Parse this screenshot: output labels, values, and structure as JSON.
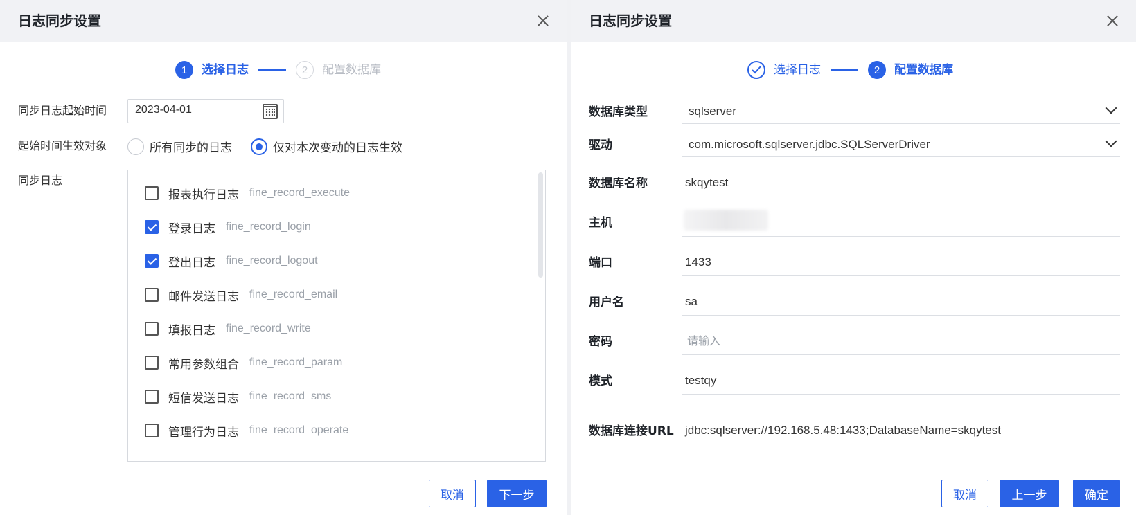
{
  "left": {
    "title": "日志同步设置",
    "steps": [
      {
        "num": "1",
        "label": "选择日志"
      },
      {
        "num": "2",
        "label": "配置数据库"
      }
    ],
    "start_time_label": "同步日志起始时间",
    "start_time_value": "2023-04-01",
    "scope_label": "起始时间生效对象",
    "scope_options": [
      {
        "label": "所有同步的日志",
        "checked": false
      },
      {
        "label": "仅对本次变动的日志生效",
        "checked": true
      }
    ],
    "sync_logs_label": "同步日志",
    "logs": [
      {
        "name": "报表执行日志",
        "table": "fine_record_execute",
        "checked": false
      },
      {
        "name": "登录日志",
        "table": "fine_record_login",
        "checked": true
      },
      {
        "name": "登出日志",
        "table": "fine_record_logout",
        "checked": true
      },
      {
        "name": "邮件发送日志",
        "table": "fine_record_email",
        "checked": false
      },
      {
        "name": "填报日志",
        "table": "fine_record_write",
        "checked": false
      },
      {
        "name": "常用参数组合",
        "table": "fine_record_param",
        "checked": false
      },
      {
        "name": "短信发送日志",
        "table": "fine_record_sms",
        "checked": false
      },
      {
        "name": "管理行为日志",
        "table": "fine_record_operate",
        "checked": false
      }
    ],
    "cancel_label": "取消",
    "next_label": "下一步"
  },
  "right": {
    "title": "日志同步设置",
    "steps": [
      {
        "label": "选择日志"
      },
      {
        "num": "2",
        "label": "配置数据库"
      }
    ],
    "fields": {
      "db_type": {
        "label": "数据库类型",
        "value": "sqlserver"
      },
      "driver": {
        "label": "驱动",
        "value": "com.microsoft.sqlserver.jdbc.SQLServerDriver"
      },
      "db_name": {
        "label": "数据库名称",
        "value": "skqytest"
      },
      "host": {
        "label": "主机",
        "value": ""
      },
      "port": {
        "label": "端口",
        "value": "1433"
      },
      "username": {
        "label": "用户名",
        "value": "sa"
      },
      "password": {
        "label": "密码",
        "placeholder": "请输入"
      },
      "schema": {
        "label": "模式",
        "value": "testqy"
      },
      "url": {
        "label": "数据库连接URL",
        "value": "jdbc:sqlserver://192.168.5.48:1433;DatabaseName=skqytest"
      }
    },
    "cancel_label": "取消",
    "prev_label": "上一步",
    "confirm_label": "确定"
  },
  "colors": {
    "accent": "#2a62e6",
    "header_bg": "#f1f2f5",
    "muted": "#9aa0a8"
  }
}
